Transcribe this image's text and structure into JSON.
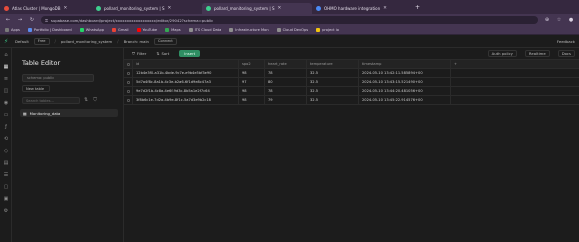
{
  "browser": {
    "tabs": [
      {
        "label": "Atlas Cluster | MongoDB",
        "color": "#e74c3c",
        "active": false
      },
      {
        "label": "pollard_monitoring_system | S",
        "color": "#3ecf8e",
        "active": false
      },
      {
        "label": "pollard_monitoring_system | S",
        "color": "#3ecf8e",
        "active": true
      },
      {
        "label": "OHMO hardware integration",
        "color": "#4b8bf5",
        "active": false
      }
    ],
    "new_tab": "+",
    "url": "supabase.com/dashboard/project/xxxxxxxxxxxxxxxxxx/editor/29042?schema=public",
    "bookmarks": [
      {
        "label": "Apps",
        "color": "#7a7a7a"
      },
      {
        "label": "Portfolio | Dashboard",
        "color": "#5a8dee"
      },
      {
        "label": "WhatsApp",
        "color": "#25d366"
      },
      {
        "label": "Gmail",
        "color": "#ea4335"
      },
      {
        "label": "YouTube",
        "color": "#ff0000"
      },
      {
        "label": "Maps",
        "color": "#34a853"
      },
      {
        "label": "ITS Cloud Data",
        "color": "#8e8e8e"
      },
      {
        "label": "Infrastructure Mon",
        "color": "#8e8e8e"
      },
      {
        "label": "Cloud DevOps",
        "color": "#8e8e8e"
      },
      {
        "label": "project io",
        "color": "#f1c40f"
      }
    ]
  },
  "app": {
    "crumbs": [
      "Default",
      "Free",
      "pollard_monitoring_system",
      "Branch: main"
    ],
    "connect_label": "Connect",
    "feedback_label": "Feedback"
  },
  "sidebar": {
    "title": "Table Editor",
    "schema_label": "schema: public",
    "new_table_label": "New table",
    "search_placeholder": "Search tables...",
    "tables": [
      {
        "label": "Monitoring_data"
      }
    ]
  },
  "toolbar": {
    "filter_label": "Filter",
    "sort_label": "Sort",
    "insert_label": "Insert",
    "auth_policy_label": "Auth policy",
    "realtime_label": "Realtime",
    "docs_label": "Docs"
  },
  "table": {
    "columns": [
      "id",
      "spo2",
      "heart_rate",
      "temperature",
      "timestamp"
    ],
    "rows": [
      {
        "id": "12b4e3f0-a31b-4bde-9c7e-e9b4e5bf3e90",
        "spo2": "98",
        "hr": "78",
        "temp": "32.5",
        "ts": "2024-05-10 13:42:11.585894+00"
      },
      {
        "id": "5d7a4f8c-8a1b-4c3e-b2a6-6f1d9e8c47a3",
        "spo2": "97",
        "hr": "80",
        "temp": "32.5",
        "ts": "2024-05-10 13:43:15.521490+00"
      },
      {
        "id": "9e7d2f1b-4c8a-4e6f-9d3c-8b5a1e2f7c64",
        "spo2": "98",
        "hr": "78",
        "temp": "32.5",
        "ts": "2024-05-10 13:44:20.481056+00"
      },
      {
        "id": "3f8b6c1e-7d2a-4b9e-8f1c-5a7d3e9b2c18",
        "spo2": "98",
        "hr": "79",
        "temp": "32.5",
        "ts": "2024-05-10 13:45:22.914576+00"
      }
    ]
  }
}
